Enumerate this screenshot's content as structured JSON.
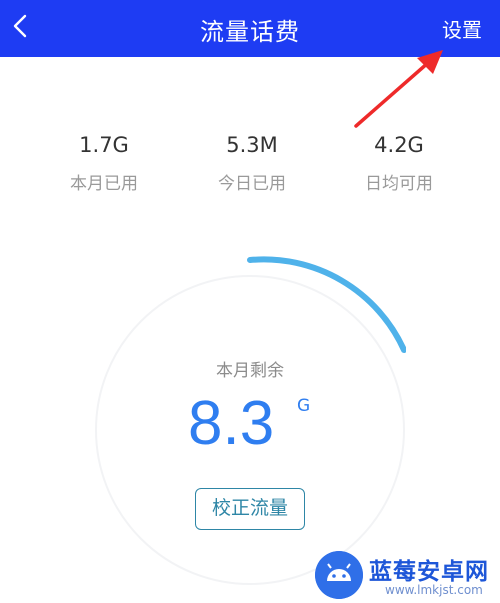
{
  "header": {
    "title": "流量话费",
    "settings_label": "设置",
    "background": "#1e3cf3",
    "back_icon": "chevron-left-icon"
  },
  "stats": [
    {
      "value": "1.7G",
      "label": "本月已用"
    },
    {
      "value": "5.3M",
      "label": "今日已用"
    },
    {
      "value": "4.2G",
      "label": "日均可用"
    }
  ],
  "gauge": {
    "label": "本月剩余",
    "value": "8.3",
    "unit": "G",
    "accent": "#4fb2ea",
    "value_color": "#2f7ef0"
  },
  "calibrate_button": "校正流量",
  "annotation": {
    "type": "red-arrow",
    "target": "settings",
    "color": "#ee2a2a"
  },
  "watermark": {
    "title": "蓝莓安卓网",
    "url": "www.lmkjst.com"
  }
}
